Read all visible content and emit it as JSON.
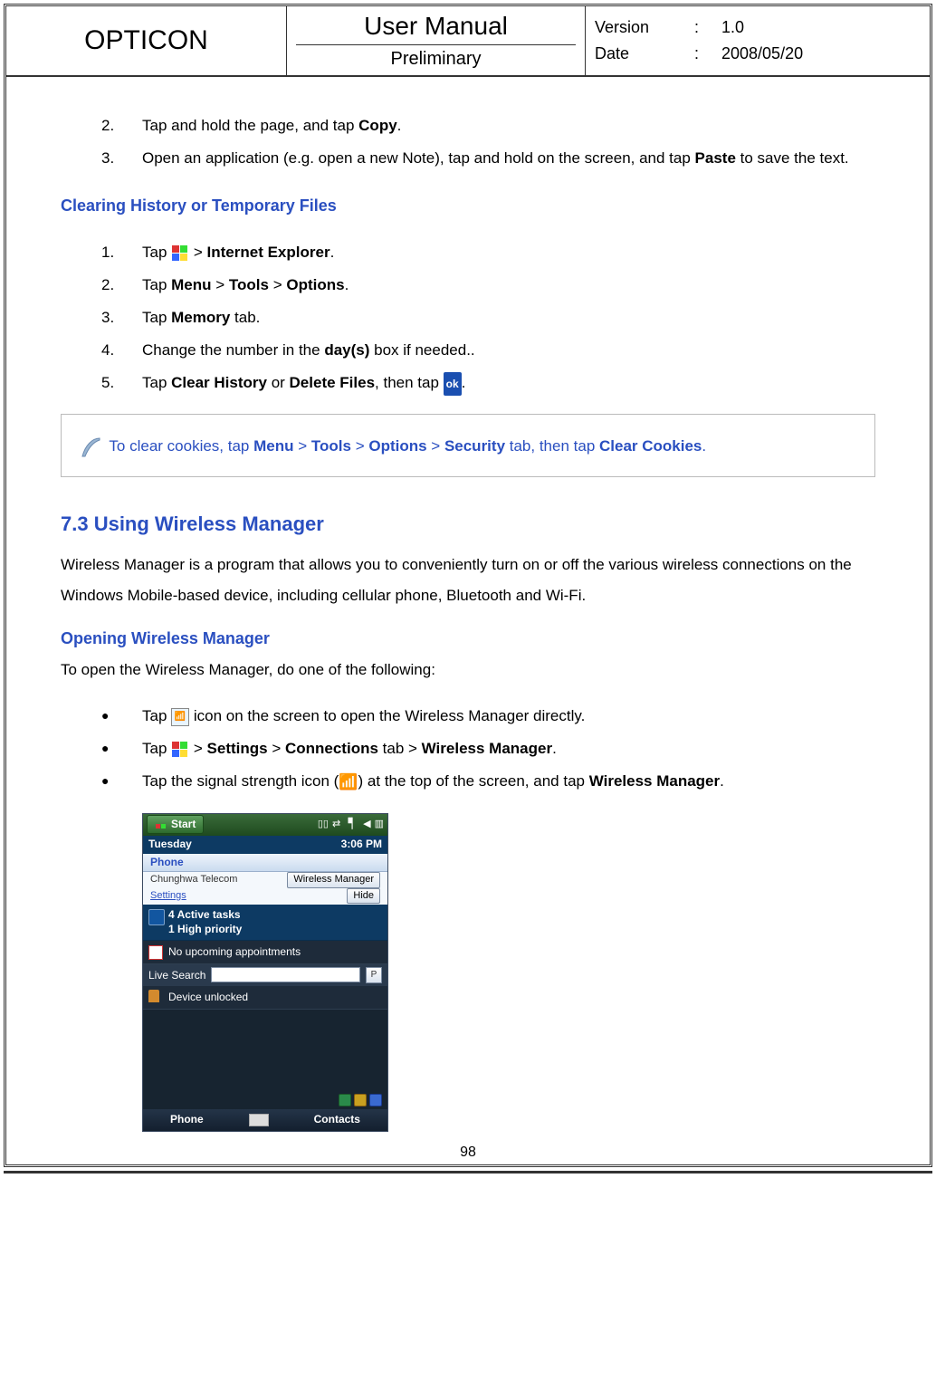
{
  "header": {
    "brand": "OPTICON",
    "title": "User Manual",
    "subtitle": "Preliminary",
    "version_label": "Version",
    "version_value": "1.0",
    "date_label": "Date",
    "date_value": "2008/05/20",
    "colon": ":"
  },
  "steps_top": [
    {
      "n": "2.",
      "pre": "Tap and hold the page, and tap ",
      "bold": "Copy",
      "post": "."
    },
    {
      "n": "3.",
      "pre": "Open an application (e.g. open a new Note), tap and hold on the screen, and tap ",
      "bold": "Paste",
      "post": " to save the text."
    }
  ],
  "heading_clear": "Clearing History or Temporary Files",
  "steps_clear": {
    "s1_n": "1.",
    "s1_pre": "Tap ",
    "s1_post_a": " > ",
    "s1_bold": "Internet Explorer",
    "s1_end": ".",
    "s2_n": "2.",
    "s2_pre": "Tap ",
    "s2_b1": "Menu",
    "s2_sep": " > ",
    "s2_b2": "Tools",
    "s2_b3": "Options",
    "s2_end": ".",
    "s3_n": "3.",
    "s3_pre": "Tap ",
    "s3_bold": "Memory",
    "s3_post": " tab.",
    "s4_n": "4.",
    "s4_pre": "Change the number in the ",
    "s4_bold": "day(s)",
    "s4_post": " box if needed..",
    "s5_n": "5.",
    "s5_pre": "Tap ",
    "s5_b1": "Clear History",
    "s5_mid": " or ",
    "s5_b2": "Delete Files",
    "s5_post": ", then tap ",
    "s5_ok": "ok",
    "s5_end": "."
  },
  "hint": {
    "pre": " To clear cookies, tap ",
    "b1": "Menu",
    "sep": " > ",
    "b2": "Tools",
    "b3": "Options",
    "mid": " > ",
    "b4": "Security",
    "mid2": " tab, then tap ",
    "b5": "Clear Cookies",
    "end": "."
  },
  "section73": {
    "title": "7.3 Using Wireless Manager",
    "intro": "Wireless Manager is a program that allows you to conveniently turn on or off the various wireless connections on the Windows Mobile-based device, including cellular phone, Bluetooth and Wi-Fi."
  },
  "heading_open": "Opening Wireless Manager",
  "open_intro": "To open the Wireless Manager, do one of the following:",
  "open_bullets": {
    "b1_pre": "Tap ",
    "b1_post": " icon on the screen to open the Wireless Manager directly.",
    "b2_pre": "Tap ",
    "b2_a": " > ",
    "b2_b1": "Settings",
    "b2_b2": "Connections",
    "b2_mid": " tab > ",
    "b2_b3": "Wireless Manager",
    "b2_end": ".",
    "b3_pre": "Tap the signal strength icon (",
    "b3_post": ") at the top of the screen, and tap ",
    "b3_bold": "Wireless Manager",
    "b3_end": "."
  },
  "screenshot": {
    "start": "Start",
    "tuesday": "Tuesday",
    "time": "3:06 PM",
    "phone": "Phone",
    "carrier": "Chunghwa Telecom",
    "wireless_manager": "Wireless Manager",
    "settings": "Settings",
    "hide": "Hide",
    "tasks_line1": "4 Active tasks",
    "tasks_line2": "1 High priority",
    "appointments": "No upcoming appointments",
    "livesearch": "Live Search",
    "device_unlocked": "Device unlocked",
    "phone_btn": "Phone",
    "contacts_btn": "Contacts",
    "search_go": "P"
  },
  "page_number": "98",
  "bullet_char": "●"
}
